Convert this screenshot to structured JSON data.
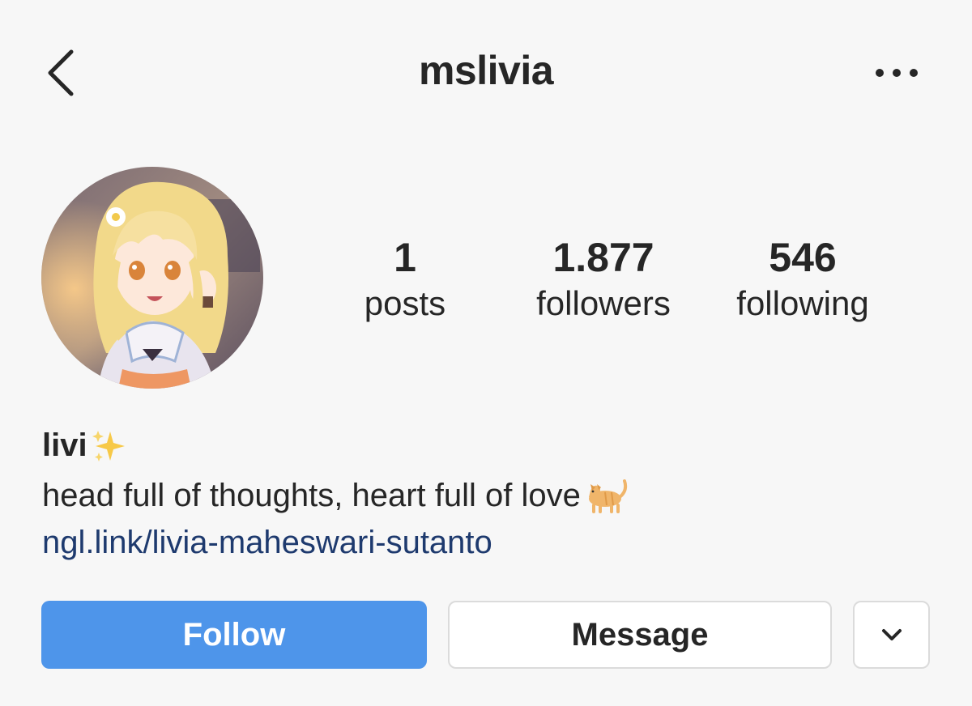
{
  "header": {
    "username": "mslivia",
    "back_icon": "chevron-left-icon",
    "more_icon": "more-horizontal-icon"
  },
  "profile": {
    "avatar": "anime-character-avatar",
    "stats": [
      {
        "value": "1",
        "label": "posts"
      },
      {
        "value": "1.877",
        "label": "followers"
      },
      {
        "value": "546",
        "label": "following"
      }
    ]
  },
  "bio": {
    "name": "livi",
    "name_emoji": "sparkles-emoji",
    "text": "head full of thoughts, heart full of love",
    "text_emoji": "cat-emoji",
    "link": "ngl.link/livia-maheswari-sutanto"
  },
  "actions": {
    "follow_label": "Follow",
    "message_label": "Message",
    "dropdown_icon": "chevron-down-icon"
  },
  "colors": {
    "background": "#f7f7f7",
    "follow_button": "#4e95ea",
    "link": "#1e3a6e",
    "text": "#262626"
  }
}
